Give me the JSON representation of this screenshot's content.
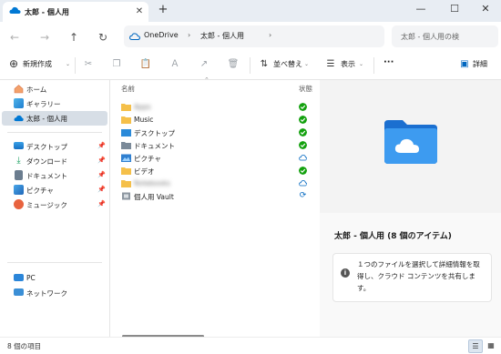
{
  "window": {
    "tab_title": "太郎 - 個人用",
    "tab_close": "✕",
    "new_tab": "+",
    "minimize": "—",
    "maximize": "☐",
    "close": "✕"
  },
  "nav": {
    "back": "←",
    "forward": "→",
    "up": "↑",
    "refresh": "↻",
    "breadcrumb": [
      "OneDrive",
      "太郎 - 個人用"
    ],
    "breadcrumb_separator": "›",
    "breadcrumb_more": "›",
    "search_placeholder": "太郎 - 個人用の検"
  },
  "commands": {
    "new_label": "新規作成",
    "sort_label": "並べ替え",
    "view_label": "表示",
    "more_label": "···",
    "details_label": "詳細"
  },
  "sidebar": {
    "top_items": [
      {
        "label": "ホーム"
      },
      {
        "label": "ギャラリー"
      },
      {
        "label": "太郎 - 個人用"
      }
    ],
    "pinned_items": [
      {
        "label": "デスクトップ"
      },
      {
        "label": "ダウンロード"
      },
      {
        "label": "ドキュメント"
      },
      {
        "label": "ピクチャ"
      },
      {
        "label": "ミュージック"
      }
    ],
    "bottom_items": [
      {
        "label": "PC"
      },
      {
        "label": "ネットワーク"
      }
    ]
  },
  "filelist": {
    "headers": {
      "name": "名前",
      "status": "状態"
    },
    "files": [
      {
        "name": "Apps",
        "blurred": true
      },
      {
        "name": "Music",
        "blurred": false
      },
      {
        "name": "デスクトップ",
        "blurred": false
      },
      {
        "name": "ドキュメント",
        "blurred": false
      },
      {
        "name": "ピクチャ",
        "blurred": false
      },
      {
        "name": "ビデオ",
        "blurred": false
      },
      {
        "name": "Notebooks",
        "blurred": true
      },
      {
        "name": "個人用 Vault",
        "blurred": false
      }
    ]
  },
  "details": {
    "title": "太郎 - 個人用 (8 個のアイテム)",
    "info_text": "１つのファイルを選択して詳細情報を取得し、クラウド コンテンツを共有します。"
  },
  "status": {
    "item_count": "8 個の項目"
  },
  "colors": {
    "accent": "#0067c0",
    "sync_green": "#13a10e",
    "folder_yellow": "#f5c04a",
    "selected_bg": "#d7dee6"
  }
}
